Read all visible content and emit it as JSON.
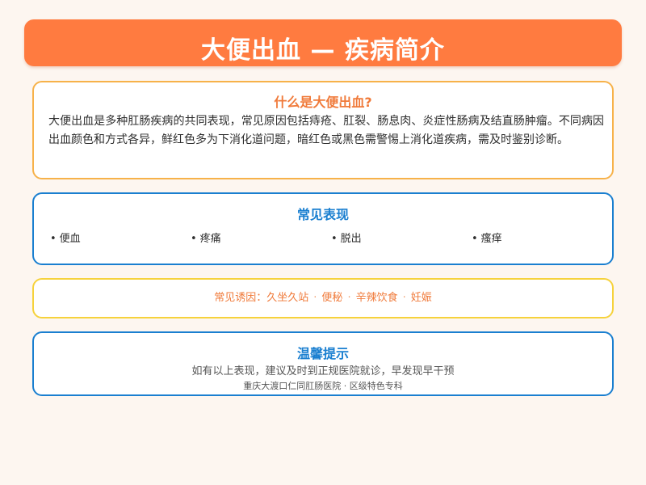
{
  "header": {
    "title": "大便出血 — 疾病简介"
  },
  "intro": {
    "title": "什么是大便出血?",
    "text": "大便出血是多种肛肠疾病的共同表现，常见原因包括痔疮、肛裂、肠息肉、炎症性肠病及结直肠肿瘤。不同病因出血颜色和方式各异，鲜红色多为下消化道问题，暗红色或黑色需警惕上消化道疾病，需及时鉴别诊断。"
  },
  "symptoms": {
    "title": "常见表现",
    "bullet": "•",
    "items": [
      "便血",
      "疼痛",
      "脱出",
      "瘙痒"
    ]
  },
  "causes": {
    "prefix": "常见诱因：",
    "separator": "·",
    "items": [
      "久坐久站",
      "便秘",
      "辛辣饮食",
      "妊娠"
    ]
  },
  "tips": {
    "title": "温馨提示",
    "text": "如有以上表现，建议及时到正规医院就诊，早发现早干预",
    "footer": "重庆大渡口仁同肛肠医院 · 区级特色专科"
  }
}
